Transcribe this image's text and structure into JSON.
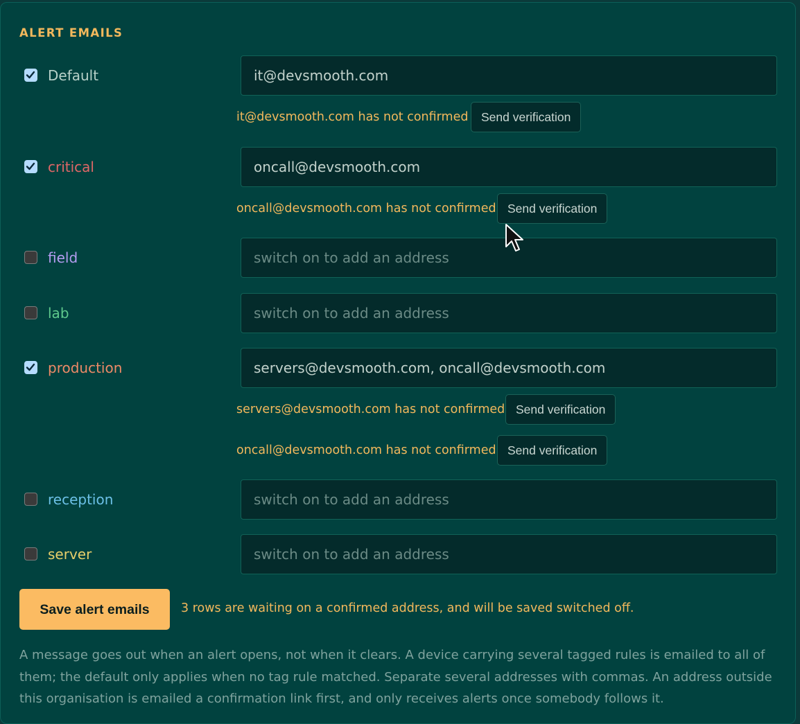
{
  "section": {
    "title": "ALERT EMAILS"
  },
  "rows": [
    {
      "label": "Default",
      "label_color": "#b8d1c9",
      "checked": true,
      "value": "it@devsmooth.com",
      "placeholder": "",
      "warnings": [
        {
          "text": "it@devsmooth.com has not confirmed",
          "button": "Send verification"
        }
      ]
    },
    {
      "label": "critical",
      "label_color": "#e06767",
      "checked": true,
      "value": "oncall@devsmooth.com",
      "placeholder": "",
      "warnings": [
        {
          "text": "oncall@devsmooth.com has not confirmed",
          "button": "Send verification"
        }
      ]
    },
    {
      "label": "field",
      "label_color": "#b49cf0",
      "checked": false,
      "value": "",
      "placeholder": "switch on to add an address",
      "warnings": []
    },
    {
      "label": "lab",
      "label_color": "#5fc98c",
      "checked": false,
      "value": "",
      "placeholder": "switch on to add an address",
      "warnings": []
    },
    {
      "label": "production",
      "label_color": "#ee8a67",
      "checked": true,
      "value": "servers@devsmooth.com, oncall@devsmooth.com",
      "placeholder": "",
      "warnings": [
        {
          "text": "servers@devsmooth.com has not confirmed",
          "button": "Send verification"
        },
        {
          "text": "oncall@devsmooth.com has not confirmed",
          "button": "Send verification"
        }
      ]
    },
    {
      "label": "reception",
      "label_color": "#6cc0e6",
      "checked": false,
      "value": "",
      "placeholder": "switch on to add an address",
      "warnings": []
    },
    {
      "label": "server",
      "label_color": "#e9cf6a",
      "checked": false,
      "value": "",
      "placeholder": "switch on to add an address",
      "warnings": []
    }
  ],
  "footer": {
    "save_label": "Save alert emails",
    "save_note": "3 rows are waiting on a confirmed address, and will be saved switched off.",
    "help_text": "A message goes out when an alert opens, not when it clears. A device carrying several tagged rules is emailed to all of them; the default only applies when no tag rule matched. Separate several addresses with commas. An address outside this organisation is emailed a confirmation link first, and only receives alerts once somebody follows it."
  },
  "colors": {
    "accent": "#f3b85c",
    "panel": "#01423f",
    "button_primary": "#fbbb62"
  },
  "cursor": {
    "icon": "pointer-arrow-icon"
  }
}
